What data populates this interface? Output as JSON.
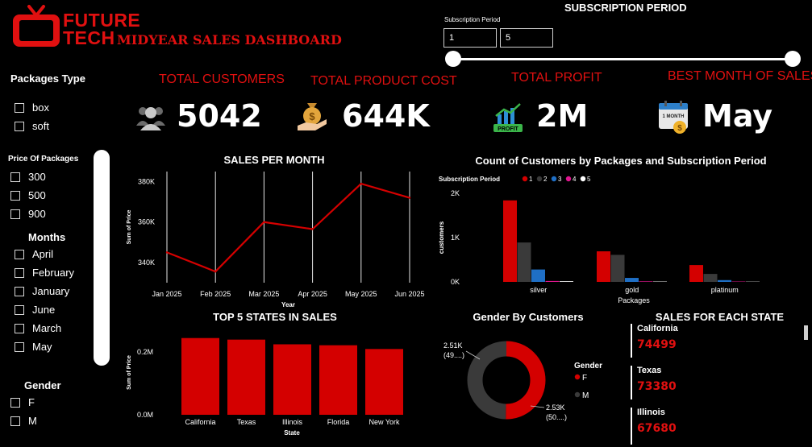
{
  "brand": {
    "line1": "FUTURE",
    "line2": "TECH",
    "dashboard_title": "MIDYEAR SALES DASHBOARD"
  },
  "subscription": {
    "title": "SUBSCRIPTION PERIOD",
    "label": "Subscription Period",
    "min_value": "1",
    "max_value": "5",
    "range": [
      1,
      5
    ]
  },
  "kpis": {
    "customers": {
      "title": "TOTAL CUSTOMERS",
      "value": "5042",
      "icon": "customers-icon"
    },
    "cost": {
      "title": "TOTAL PRODUCT COST",
      "value": "644K",
      "icon": "money-bag-hand-icon"
    },
    "profit": {
      "title": "TOTAL PROFIT",
      "value": "2M",
      "icon": "profit-chart-icon",
      "icon_label": "PROFIT"
    },
    "best_month": {
      "title": "BEST MONTH OF SALES",
      "value": "May",
      "icon": "calendar-icon",
      "icon_label": "1 MONTH"
    }
  },
  "filters": {
    "packages": {
      "title": "Packages Type",
      "options": [
        "box",
        "soft"
      ]
    },
    "price": {
      "title": "Price Of Packages",
      "options": [
        "300",
        "500",
        "900"
      ]
    },
    "months": {
      "title": "Months",
      "options": [
        "April",
        "February",
        "January",
        "June",
        "March",
        "May"
      ]
    },
    "gender": {
      "title": "Gender",
      "options": [
        "F",
        "M"
      ]
    }
  },
  "colors": {
    "accent": "#e01010",
    "bar_red": "#d40000",
    "dark_gray": "#3a3a3a",
    "gray2": "#555555",
    "blue": "#1f6fc5",
    "magenta": "#e0168f",
    "white": "#ffffff"
  },
  "chart_data": [
    {
      "type": "line",
      "title": "SALES PER MONTH",
      "xlabel": "Year",
      "ylabel": "Sum of Price",
      "x": [
        "Jan 2025",
        "Feb 2025",
        "Mar 2025",
        "Apr 2025",
        "May 2025",
        "Jun 2025"
      ],
      "values": [
        345000,
        335500,
        360000,
        356500,
        379000,
        372000
      ],
      "ylim": [
        330000,
        385000
      ],
      "yticks": [
        340000,
        360000,
        380000
      ],
      "ytick_labels": [
        "340K",
        "360K",
        "380K"
      ],
      "grid": "vertical"
    },
    {
      "type": "bar",
      "title": "Count of Customers by Packages and Subscription Period",
      "xlabel": "Packages",
      "ylabel": "customers",
      "legend_title": "Subscription Period",
      "legend_position": "top-left",
      "categories": [
        "silver",
        "gold",
        "platinum"
      ],
      "series": [
        {
          "name": "1",
          "values": [
            1840,
            690,
            380
          ]
        },
        {
          "name": "2",
          "values": [
            890,
            610,
            180
          ]
        },
        {
          "name": "3",
          "values": [
            280,
            90,
            40
          ]
        },
        {
          "name": "4",
          "values": [
            20,
            12,
            8
          ]
        },
        {
          "name": "5",
          "values": [
            15,
            8,
            5
          ]
        }
      ],
      "ylim": [
        0,
        2000
      ],
      "yticks": [
        0,
        1000,
        2000
      ],
      "ytick_labels": [
        "0K",
        "1K",
        "2K"
      ]
    },
    {
      "type": "bar",
      "title": "TOP 5 STATES IN SALES",
      "xlabel": "State",
      "ylabel": "Sum of Price",
      "categories": [
        "California",
        "Texas",
        "Illinois",
        "Florida",
        "New York"
      ],
      "values": [
        245000,
        240000,
        225000,
        222000,
        210000
      ],
      "ylim": [
        0,
        270000
      ],
      "yticks": [
        0,
        200000
      ],
      "ytick_labels": [
        "0.0M",
        "0.2M"
      ]
    },
    {
      "type": "pie",
      "subtype": "donut",
      "title": "Gender By Customers",
      "legend_title": "Gender",
      "categories": [
        "F",
        "M"
      ],
      "values": [
        2530,
        2510
      ],
      "labels": [
        [
          "2.53K",
          "(50....)"
        ],
        [
          "2.51K",
          "(49....)"
        ]
      ]
    },
    {
      "type": "table",
      "title": "SALES FOR EACH STATE",
      "rows": [
        {
          "state": "California",
          "value": "74499"
        },
        {
          "state": "Texas",
          "value": "73380"
        },
        {
          "state": "Illinois",
          "value": "67680"
        }
      ]
    }
  ]
}
